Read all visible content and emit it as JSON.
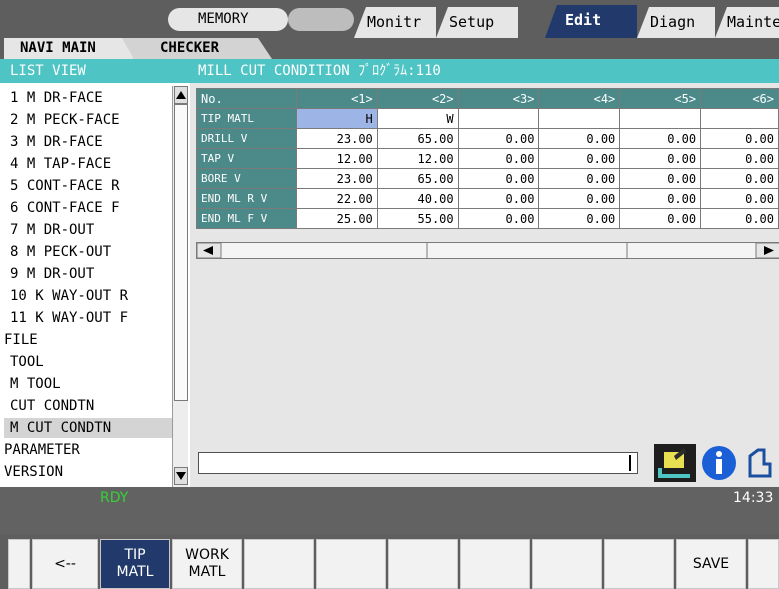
{
  "header": {
    "mode": "MEMORY",
    "tabs": [
      {
        "label": "Monitr",
        "active": false
      },
      {
        "label": "Setup",
        "active": false
      },
      {
        "label": "Edit",
        "active": true
      },
      {
        "label": "Diagn",
        "active": false
      },
      {
        "label": "Mainte",
        "active": false
      }
    ]
  },
  "subtabs": {
    "navi": "NAVI MAIN",
    "checker": "CHECKER"
  },
  "sidebar": {
    "header": "LIST VIEW",
    "items": [
      {
        "label": "  1 M DR-FACE"
      },
      {
        "label": "  2 M PECK-FACE"
      },
      {
        "label": "  3 M DR-FACE"
      },
      {
        "label": "  4 M TAP-FACE"
      },
      {
        "label": "  5 CONT-FACE R"
      },
      {
        "label": "  6 CONT-FACE F"
      },
      {
        "label": "  7 M DR-OUT"
      },
      {
        "label": "  8 M PECK-OUT"
      },
      {
        "label": "  9 M DR-OUT"
      },
      {
        "label": " 10 K WAY-OUT R"
      },
      {
        "label": " 11 K WAY-OUT F"
      },
      {
        "label": "FILE"
      },
      {
        "label": " TOOL"
      },
      {
        "label": " M TOOL"
      },
      {
        "label": " CUT CONDTN"
      },
      {
        "label": " M CUT CONDTN",
        "selected": true
      },
      {
        "label": "PARAMETER"
      },
      {
        "label": "VERSION"
      }
    ]
  },
  "main": {
    "title": "MILL CUT CONDITION ﾌﾟﾛｸﾞﾗﾑ:110",
    "columns": [
      "No.",
      "<1>",
      "<2>",
      "<3>",
      "<4>",
      "<5>",
      "<6>"
    ],
    "rows": [
      {
        "label": "TIP MATL",
        "values": [
          "H",
          "W",
          "",
          "",
          "",
          ""
        ]
      },
      {
        "label": "DRILL    V",
        "values": [
          "23.00",
          "65.00",
          "0.00",
          "0.00",
          "0.00",
          "0.00"
        ]
      },
      {
        "label": "TAP      V",
        "values": [
          "12.00",
          "12.00",
          "0.00",
          "0.00",
          "0.00",
          "0.00"
        ]
      },
      {
        "label": "BORE     V",
        "values": [
          "23.00",
          "65.00",
          "0.00",
          "0.00",
          "0.00",
          "0.00"
        ]
      },
      {
        "label": "END ML R V",
        "values": [
          "22.00",
          "40.00",
          "0.00",
          "0.00",
          "0.00",
          "0.00"
        ]
      },
      {
        "label": "END ML F V",
        "values": [
          "25.00",
          "55.00",
          "0.00",
          "0.00",
          "0.00",
          "0.00"
        ]
      }
    ],
    "input_value": ""
  },
  "status": {
    "state": "RDY",
    "time": "14:33"
  },
  "softkeys": [
    {
      "label": "<--"
    },
    {
      "label": "TIP\nMATL",
      "active": true
    },
    {
      "label": "WORK\nMATL"
    },
    {
      "label": ""
    },
    {
      "label": ""
    },
    {
      "label": ""
    },
    {
      "label": ""
    },
    {
      "label": ""
    },
    {
      "label": ""
    },
    {
      "label": "SAVE"
    },
    {
      "label": ""
    }
  ],
  "icons": {
    "tool": "tool-change-icon",
    "info": "info-icon",
    "extra": "machine-icon"
  },
  "colors": {
    "accent": "#4fc4c4",
    "active_tab": "#213a6b",
    "grid_header": "#4c8a8a",
    "highlight": "#9db4e6",
    "ready": "#35d235"
  }
}
